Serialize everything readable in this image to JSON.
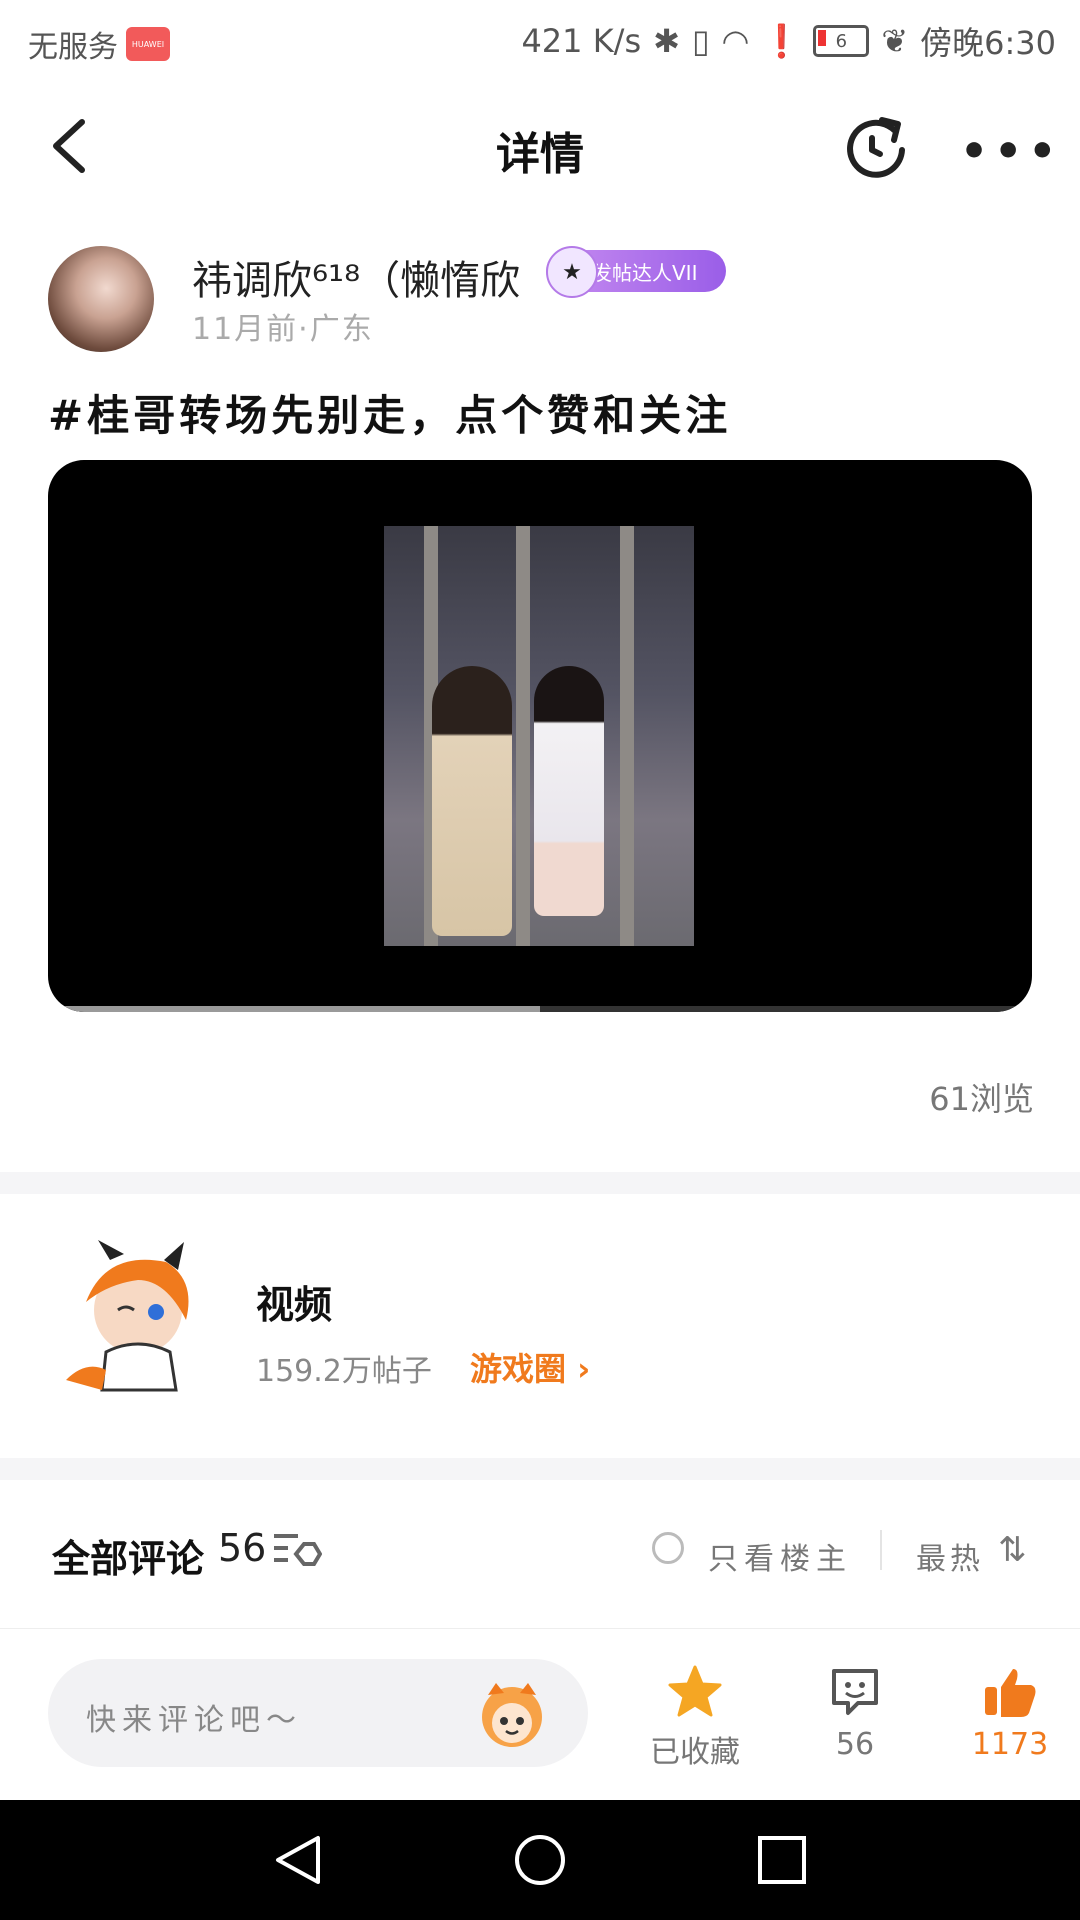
{
  "status_bar": {
    "carrier": "无服务",
    "badge": "HUAWEI",
    "speed": "421 K/s",
    "battery": "6",
    "time": "傍晚6:30"
  },
  "header": {
    "title": "详情"
  },
  "post": {
    "author_name": "祎调欣⁶¹⁸（懒惰欣",
    "badge_label": "发帖达人VII",
    "meta": "11月前·广东",
    "title": "#桂哥转场先别走，点个赞和关注",
    "video_progress": 0.5,
    "views": "61浏览"
  },
  "circle": {
    "name": "视频",
    "posts": "159.2万帖子",
    "link": "游戏圈 ›"
  },
  "comments": {
    "title": "全部评论",
    "count": "56",
    "only_owner": "只看楼主",
    "sort": "最热",
    "sort_icon": "⇅"
  },
  "bottom_bar": {
    "placeholder": "快来评论吧～",
    "favorite_label": "已收藏",
    "comment_count": "56",
    "like_count": "1173",
    "accent": "#f5a623",
    "like_color": "#f07a1d"
  }
}
